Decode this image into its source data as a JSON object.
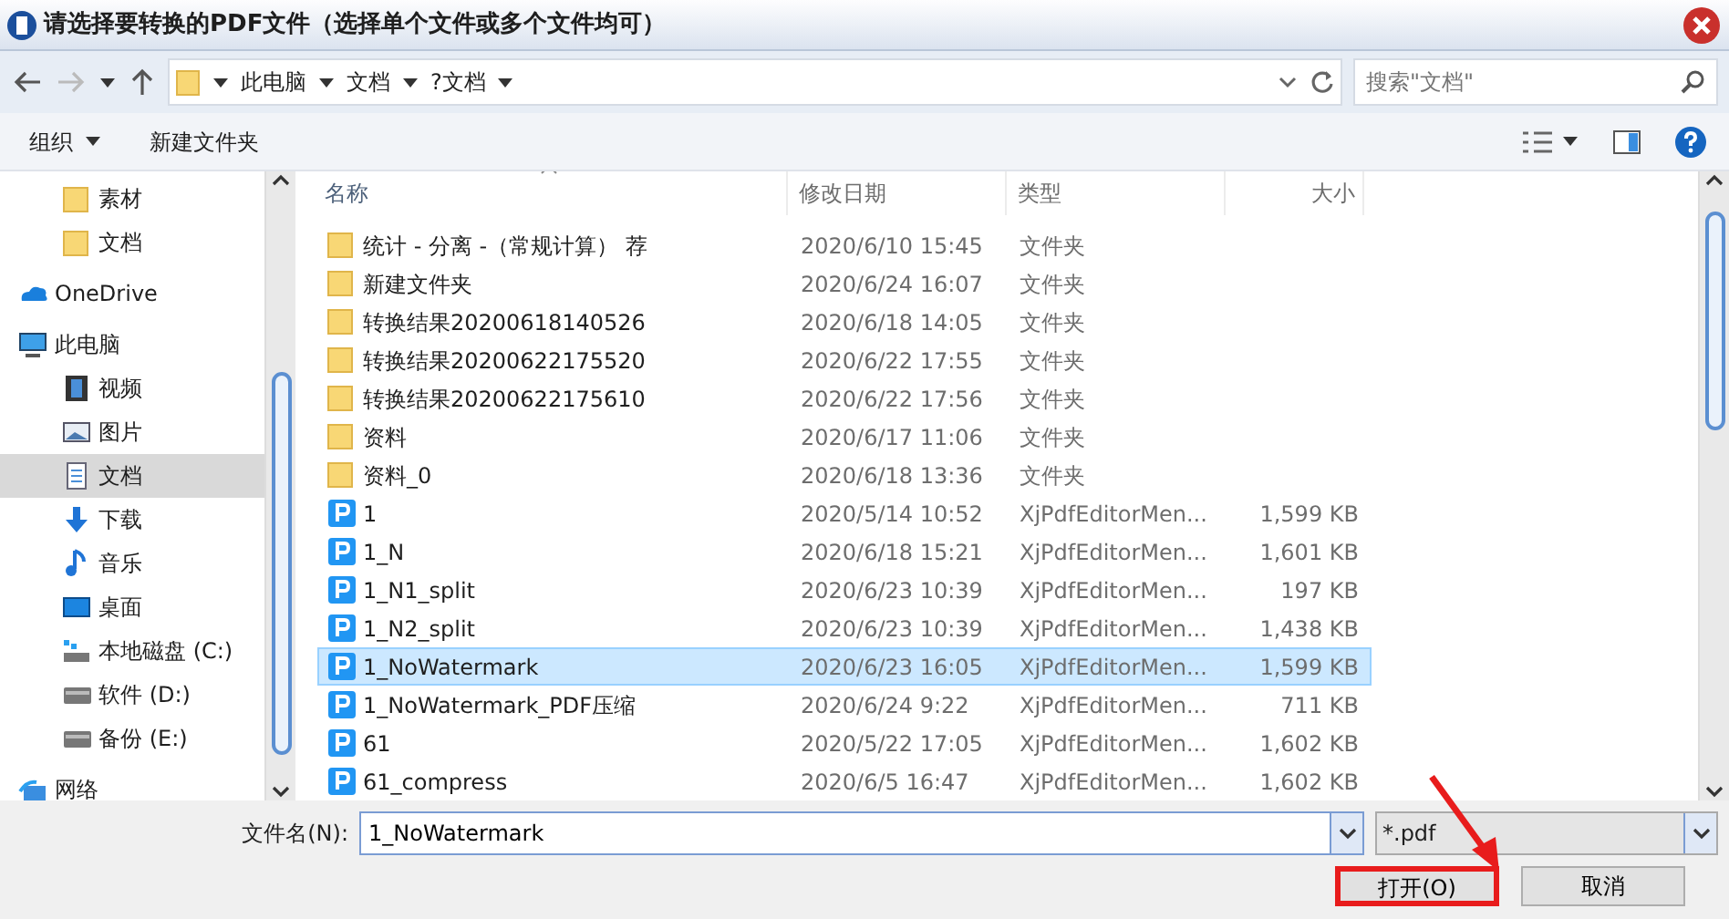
{
  "window": {
    "title": "请选择要转换的PDF文件（选择单个文件或多个文件均可）"
  },
  "address": {
    "segments": [
      "此电脑",
      "文档",
      "?文档"
    ],
    "search_placeholder": "搜索\"文档\""
  },
  "toolbar": [
    {
      "label": "组织",
      "dropdown": true
    },
    {
      "label": "新建文件夹",
      "dropdown": false
    }
  ],
  "sidebar": {
    "items": [
      {
        "kind": "group",
        "children": [
          {
            "label": "素材",
            "kind": "folder",
            "selected": false
          },
          {
            "label": "文档",
            "kind": "folder",
            "selected": false
          }
        ]
      },
      {
        "label": "OneDrive",
        "kind": "cloud",
        "selected": false
      },
      {
        "label": "此电脑",
        "kind": "pc",
        "selected": false,
        "children": [
          {
            "label": "视频",
            "kind": "video",
            "selected": false
          },
          {
            "label": "图片",
            "kind": "picture",
            "selected": false
          },
          {
            "label": "文档",
            "kind": "document",
            "selected": true
          },
          {
            "label": "下载",
            "kind": "download",
            "selected": false
          },
          {
            "label": "音乐",
            "kind": "music",
            "selected": false
          },
          {
            "label": "桌面",
            "kind": "desktop",
            "selected": false
          },
          {
            "label": "本地磁盘 (C:)",
            "kind": "system-drive",
            "selected": false
          },
          {
            "label": "软件 (D:)",
            "kind": "drive",
            "selected": false
          },
          {
            "label": "备份 (E:)",
            "kind": "drive",
            "selected": false
          }
        ]
      },
      {
        "label": "网络",
        "kind": "network",
        "selected": false
      }
    ]
  },
  "table": {
    "columns": [
      "名称",
      "修改日期",
      "类型",
      "大小"
    ],
    "rows": [
      {
        "name": "统计 - 分离 -（常规计算） 荐",
        "date": "2020/6/10 15:45",
        "type": "文件夹",
        "size": "",
        "kind": "folder",
        "selected": false
      },
      {
        "name": "新建文件夹",
        "date": "2020/6/24 16:07",
        "type": "文件夹",
        "size": "",
        "kind": "folder",
        "selected": false
      },
      {
        "name": "转换结果20200618140526",
        "date": "2020/6/18 14:05",
        "type": "文件夹",
        "size": "",
        "kind": "folder",
        "selected": false
      },
      {
        "name": "转换结果20200622175520",
        "date": "2020/6/22 17:55",
        "type": "文件夹",
        "size": "",
        "kind": "folder",
        "selected": false
      },
      {
        "name": "转换结果20200622175610",
        "date": "2020/6/22 17:56",
        "type": "文件夹",
        "size": "",
        "kind": "folder",
        "selected": false
      },
      {
        "name": "资料",
        "date": "2020/6/17 11:06",
        "type": "文件夹",
        "size": "",
        "kind": "folder",
        "selected": false
      },
      {
        "name": "资料_0",
        "date": "2020/6/18 13:36",
        "type": "文件夹",
        "size": "",
        "kind": "folder",
        "selected": false
      },
      {
        "name": "1",
        "date": "2020/5/14 10:52",
        "type": "XjPdfEditorMen...",
        "size": "1,599 KB",
        "kind": "pdf",
        "selected": false
      },
      {
        "name": "1_N",
        "date": "2020/6/18 15:21",
        "type": "XjPdfEditorMen...",
        "size": "1,601 KB",
        "kind": "pdf",
        "selected": false
      },
      {
        "name": "1_N1_split",
        "date": "2020/6/23 10:39",
        "type": "XjPdfEditorMen...",
        "size": "197 KB",
        "kind": "pdf",
        "selected": false
      },
      {
        "name": "1_N2_split",
        "date": "2020/6/23 10:39",
        "type": "XjPdfEditorMen...",
        "size": "1,438 KB",
        "kind": "pdf",
        "selected": false
      },
      {
        "name": "1_NoWatermark",
        "date": "2020/6/23 16:05",
        "type": "XjPdfEditorMen...",
        "size": "1,599 KB",
        "kind": "pdf",
        "selected": true
      },
      {
        "name": "1_NoWatermark_PDF压缩",
        "date": "2020/6/24 9:22",
        "type": "XjPdfEditorMen...",
        "size": "711 KB",
        "kind": "pdf",
        "selected": false
      },
      {
        "name": "61",
        "date": "2020/5/22 17:05",
        "type": "XjPdfEditorMen...",
        "size": "1,602 KB",
        "kind": "pdf",
        "selected": false
      },
      {
        "name": "61_compress",
        "date": "2020/6/5 16:47",
        "type": "XjPdfEditorMen...",
        "size": "1,602 KB",
        "kind": "pdf",
        "selected": false
      }
    ]
  },
  "filename": {
    "label": "文件名(N):",
    "value": "1_NoWatermark",
    "filter": "*.pdf"
  },
  "buttons": [
    {
      "label": "打开(O)",
      "highlighted": true
    },
    {
      "label": "取消",
      "highlighted": false
    }
  ]
}
